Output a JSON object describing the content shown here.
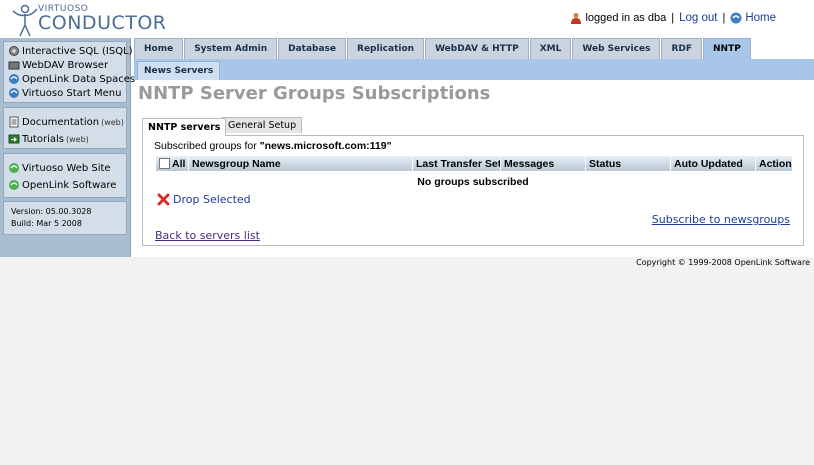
{
  "logo": {
    "line1": "VIRTUOSO",
    "line2": "CONDUCTOR"
  },
  "userbar": {
    "logged_in": "logged in as dba",
    "sep": "|",
    "logout": "Log out",
    "home": "Home"
  },
  "sidebar": {
    "group1": [
      "Interactive SQL (ISQL)",
      "WebDAV Browser",
      "OpenLink Data Spaces",
      "Virtuoso Start Menu"
    ],
    "group2": [
      {
        "label": "Documentation",
        "suffix": "(web)"
      },
      {
        "label": "Tutorials",
        "suffix": "(web)"
      }
    ],
    "group3": [
      "Virtuoso Web Site",
      "OpenLink Software"
    ],
    "version": "Version: 05.00.3028",
    "build": "Build: Mar 5 2008"
  },
  "tabs": [
    "Home",
    "System Admin",
    "Database",
    "Replication",
    "WebDAV & HTTP",
    "XML",
    "Web Services",
    "RDF",
    "NNTP"
  ],
  "active_tab": "NNTP",
  "subtab": "News Servers",
  "page_title": "NNTP Server Groups Subscriptions",
  "inner_tabs": {
    "active": "NNTP servers",
    "other": "General Setup"
  },
  "subscribed_prefix": "Subscribed groups for ",
  "subscribed_server": "\"news.microsoft.com:119\"",
  "columns": {
    "all": "All",
    "name": "Newsgroup Name",
    "last": "Last Transfer Set",
    "messages": "Messages",
    "status": "Status",
    "auto": "Auto Updated",
    "action": "Action"
  },
  "empty_message": "No groups subscribed",
  "drop_selected": "Drop Selected",
  "subscribe_link": "Subscribe to newsgroups",
  "back_link": "Back to servers list",
  "copyright": "Copyright © 1999-2008 OpenLink Software"
}
